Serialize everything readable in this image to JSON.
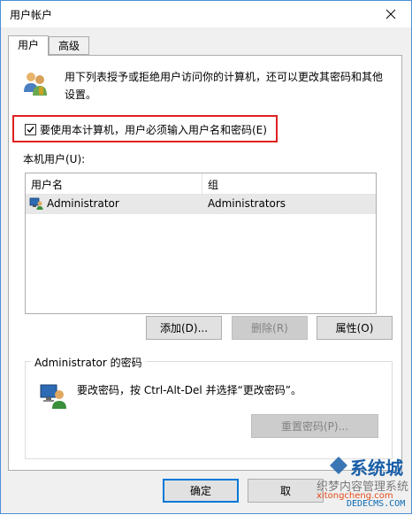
{
  "window": {
    "title": "用户帐户"
  },
  "tabs": [
    {
      "label": "用户",
      "active": true
    },
    {
      "label": "高级",
      "active": false
    }
  ],
  "intro_text": "用下列表授予或拒绝用户访问你的计算机，还可以更改其密码和其他设置。",
  "require_login_checkbox": {
    "label": "要使用本计算机，用户必须输入用户名和密码(E)",
    "checked": true
  },
  "users_label": "本机用户(U):",
  "users_table": {
    "columns": [
      "用户名",
      "组"
    ],
    "rows": [
      {
        "name": "Administrator",
        "group": "Administrators",
        "selected": true
      }
    ]
  },
  "buttons": {
    "add": "添加(D)...",
    "remove": "删除(R)",
    "properties": "属性(O)",
    "reset_password": "重置密码(P)...",
    "ok": "确定",
    "cancel": "取"
  },
  "password_group": {
    "title": "Administrator 的密码",
    "text": "要改密码，按 Ctrl-Alt-Del 并选择“更改密码”。"
  },
  "watermark": {
    "brand": "系统城",
    "line1": "织梦内容管理系统",
    "line2": "xitongcheng.com",
    "line3": "DEDECMS.COM"
  },
  "colors": {
    "accent": "#0078d7",
    "highlight": "#e02020",
    "selected_row": "#e8e8e8"
  }
}
